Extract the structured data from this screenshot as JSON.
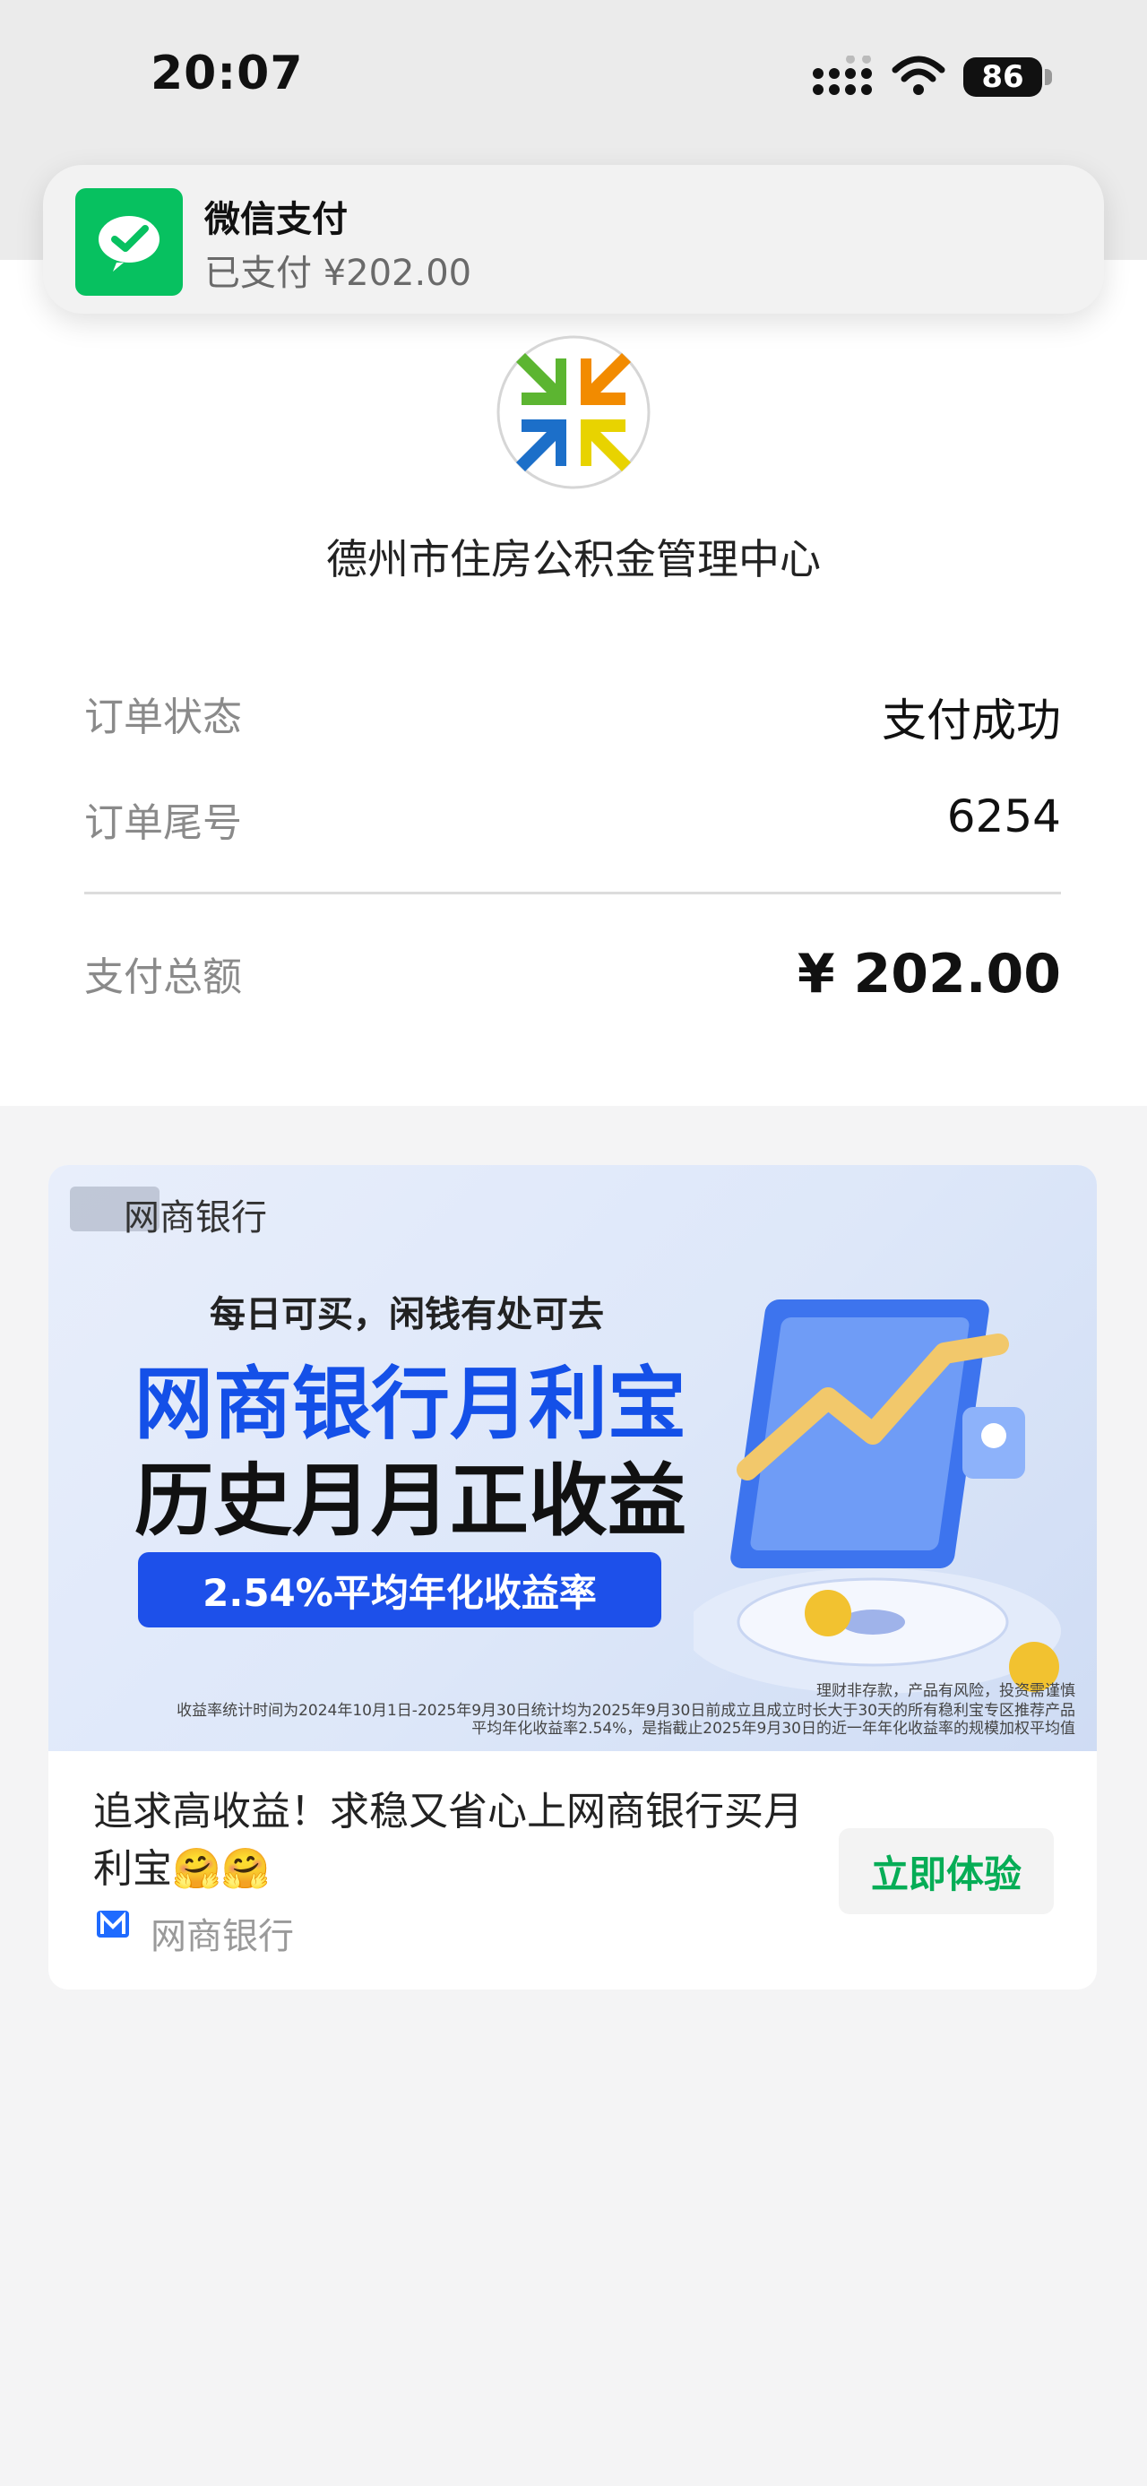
{
  "status_bar": {
    "time": "20:07",
    "battery_level": "86",
    "icons": [
      "signal-icon",
      "wifi-icon",
      "battery-icon"
    ]
  },
  "notification": {
    "app_name": "微信支付",
    "message": "已支付 ¥202.00",
    "icon": "wechat-pay-icon",
    "accent_color": "#07c160"
  },
  "receipt": {
    "merchant_name": "德州市住房公积金管理中心",
    "rows": [
      {
        "label": "订单状态",
        "value": "支付成功"
      },
      {
        "label": "订单尾号",
        "value": "6254"
      }
    ],
    "total_label": "支付总额",
    "total_value": "¥ 202.00"
  },
  "ad": {
    "banner": {
      "brand": "网商银行",
      "tagline": "每日可买，闲钱有处可去",
      "headline1": "网商银行月利宝",
      "headline2": "历史月月正收益",
      "rate": "2.54%平均年化收益率",
      "disclaimer1": "理财非存款，产品有风险，投资需谨慎",
      "disclaimer2": "收益率统计时间为2024年10月1日-2025年9月30日统计均为2025年9月30日前成立且成立时长大于30天的所有稳利宝专区推荐产品",
      "disclaimer3": "平均年化收益率2.54%，是指截止2025年9月30日的近一年年化收益率的规模加权平均值"
    },
    "text": "追求高收益！求稳又省心上网商银行买月利宝🤗🤗",
    "source": "网商银行",
    "cta": "立即体验",
    "cta_color": "#06ad56"
  }
}
